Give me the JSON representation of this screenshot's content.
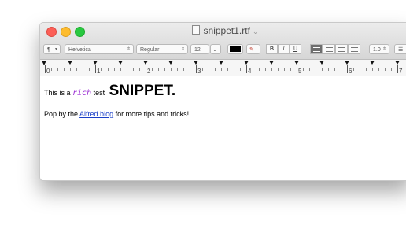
{
  "window": {
    "title": "snippet1.rtf"
  },
  "toolbar": {
    "paragraph_style": "¶",
    "font_family": "Helvetica",
    "font_style": "Regular",
    "font_size": "12",
    "bold_label": "B",
    "italic_label": "I",
    "underline_label": "U",
    "line_spacing": "1.0",
    "text_color": "#000000"
  },
  "ruler": {
    "labels": [
      "0",
      "1",
      "2",
      "3",
      "4",
      "5",
      "6",
      "7"
    ]
  },
  "document": {
    "line1": {
      "part1": "This is a ",
      "rich_word": "rich",
      "part2": " test ",
      "big_word": "SNIPPET."
    },
    "line2": {
      "part1": "Pop by the ",
      "link_text": "Alfred blog",
      "part2": " for more tips and tricks!"
    },
    "colors": {
      "rich_word": "#9b2fd3",
      "link": "#1a3fc8"
    }
  }
}
